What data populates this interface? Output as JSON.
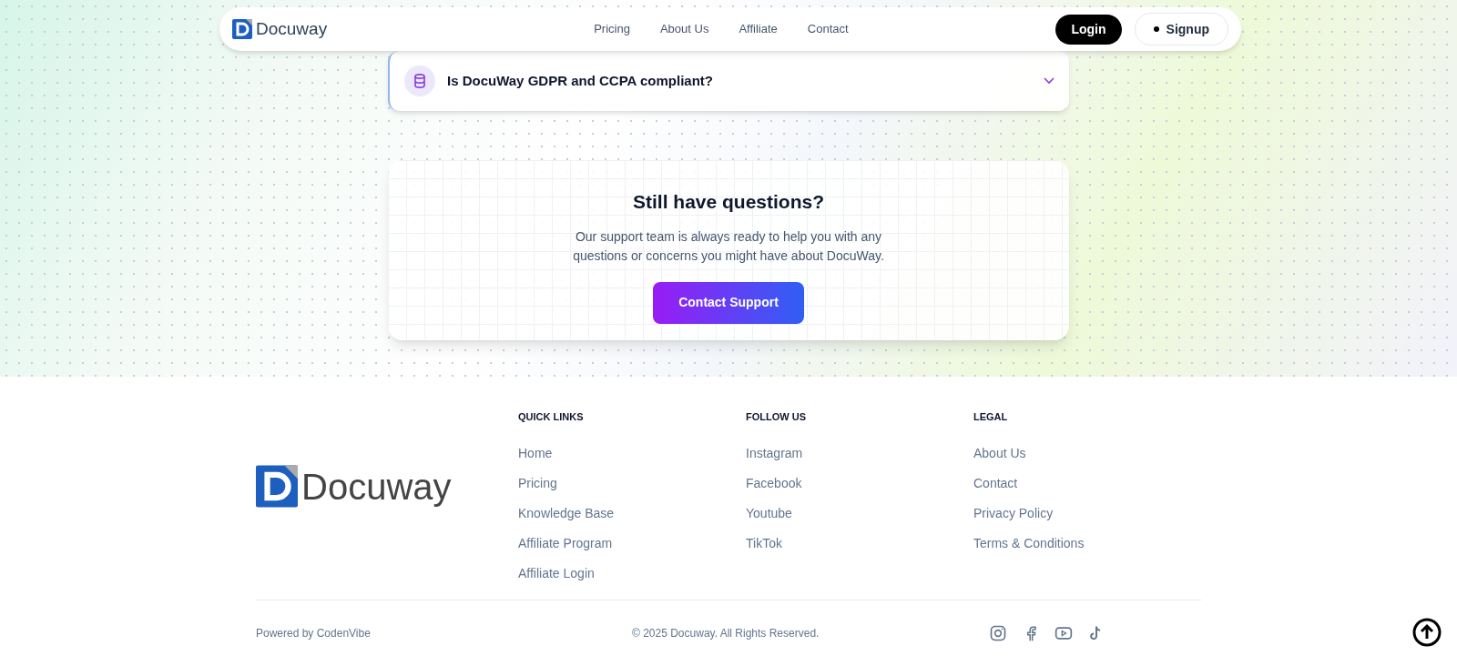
{
  "nav": {
    "logo": "Docuway",
    "links": [
      "Pricing",
      "About Us",
      "Affiliate",
      "Contact"
    ],
    "login": "Login",
    "signup": "Signup"
  },
  "faq": [
    {
      "question": "Is DocuWay GDPR and CCPA compliant?",
      "expanded": false,
      "kind": "database"
    }
  ],
  "support": {
    "title": "Still have questions?",
    "text": "Our support team is always ready to help you with any questions or concerns you might have about DocuWay.",
    "button": "Contact Support"
  },
  "footer": {
    "logo": "Docuway",
    "columns": [
      {
        "heading": "QUICK LINKS",
        "links": [
          "Home",
          "Pricing",
          "Knowledge Base",
          "Affiliate Program",
          "Affiliate Login"
        ]
      },
      {
        "heading": "FOLLOW US",
        "links": [
          "Instagram",
          "Facebook",
          "Youtube",
          "TikTok"
        ]
      },
      {
        "heading": "LEGAL",
        "links": [
          "About Us",
          "Contact",
          "Privacy Policy",
          "Terms & Conditions"
        ]
      }
    ],
    "powered": "Powered by CodenVibe",
    "copyright": "© 2025 Docuway. All Rights Reserved.",
    "social": [
      {
        "kind": "instagram"
      },
      {
        "kind": "facebook"
      },
      {
        "kind": "youtube"
      },
      {
        "kind": "tiktok"
      }
    ]
  }
}
